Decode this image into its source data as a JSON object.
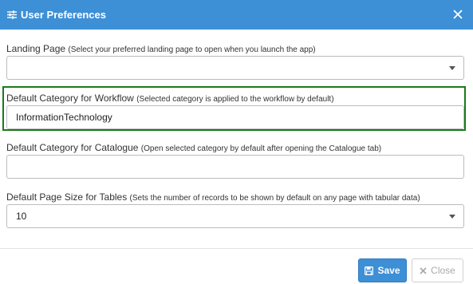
{
  "dialog": {
    "title": "User Preferences",
    "title_icon": "sliders-icon",
    "close_icon": "close-icon"
  },
  "fields": {
    "landing_page": {
      "label": "Landing Page",
      "hint": "(Select your preferred landing page to open when you launch the app)",
      "value": ""
    },
    "workflow_category": {
      "label": "Default Category for Workflow",
      "hint": "(Selected category is applied to the workflow by default)",
      "value": "InformationTechnology"
    },
    "catalogue_category": {
      "label": "Default Category for Catalogue",
      "hint": "(Open selected category by default after opening the Catalogue tab)",
      "value": ""
    },
    "page_size": {
      "label": "Default Page Size for Tables",
      "hint": "(Sets the number of records to be shown by default on any page with tabular data)",
      "value": "10"
    }
  },
  "footer": {
    "save_label": "Save",
    "close_label": "Close"
  },
  "colors": {
    "header": "#3d8fd6",
    "highlight": "#1a7a1a"
  }
}
